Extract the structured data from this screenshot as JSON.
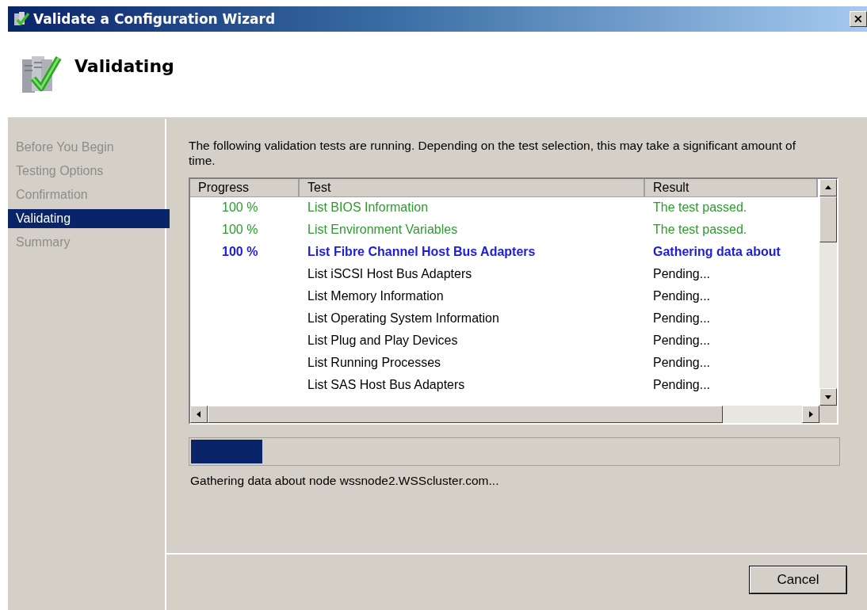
{
  "window": {
    "title": "Validate a Configuration Wizard",
    "close": "✕"
  },
  "header": {
    "title": "Validating"
  },
  "sidebar": {
    "items": [
      {
        "label": "Before You Begin",
        "selected": false
      },
      {
        "label": "Testing Options",
        "selected": false
      },
      {
        "label": "Confirmation",
        "selected": false
      },
      {
        "label": "Validating",
        "selected": true
      },
      {
        "label": "Summary",
        "selected": false
      }
    ]
  },
  "intro": "The following validation tests are running. Depending on the test selection, this may take a significant amount of time.",
  "table": {
    "columns": [
      "Progress",
      "Test",
      "Result"
    ],
    "rows": [
      {
        "progress": "100 %",
        "test": "List BIOS Information",
        "result": "The test passed.",
        "kind": "passed"
      },
      {
        "progress": "100 %",
        "test": "List Environment Variables",
        "result": "The test passed.",
        "kind": "passed"
      },
      {
        "progress": "100 %",
        "test": "List Fibre Channel Host Bus Adapters",
        "result": "Gathering data about",
        "kind": "running"
      },
      {
        "test": "List iSCSI Host Bus Adapters",
        "result": "Pending...",
        "kind": "pending"
      },
      {
        "test": "List Memory Information",
        "result": "Pending...",
        "kind": "pending"
      },
      {
        "test": "List Operating System Information",
        "result": "Pending...",
        "kind": "pending"
      },
      {
        "test": "List Plug and Play Devices",
        "result": "Pending...",
        "kind": "pending"
      },
      {
        "test": "List Running Processes",
        "result": "Pending...",
        "kind": "pending"
      },
      {
        "test": "List SAS Host Bus Adapters",
        "result": "Pending...",
        "kind": "pending"
      }
    ]
  },
  "progress": {
    "level": 0.11
  },
  "status": "Gathering data about node wssnode2.WSScluster.com...",
  "buttons": [
    {
      "label": "Cancel"
    }
  ]
}
